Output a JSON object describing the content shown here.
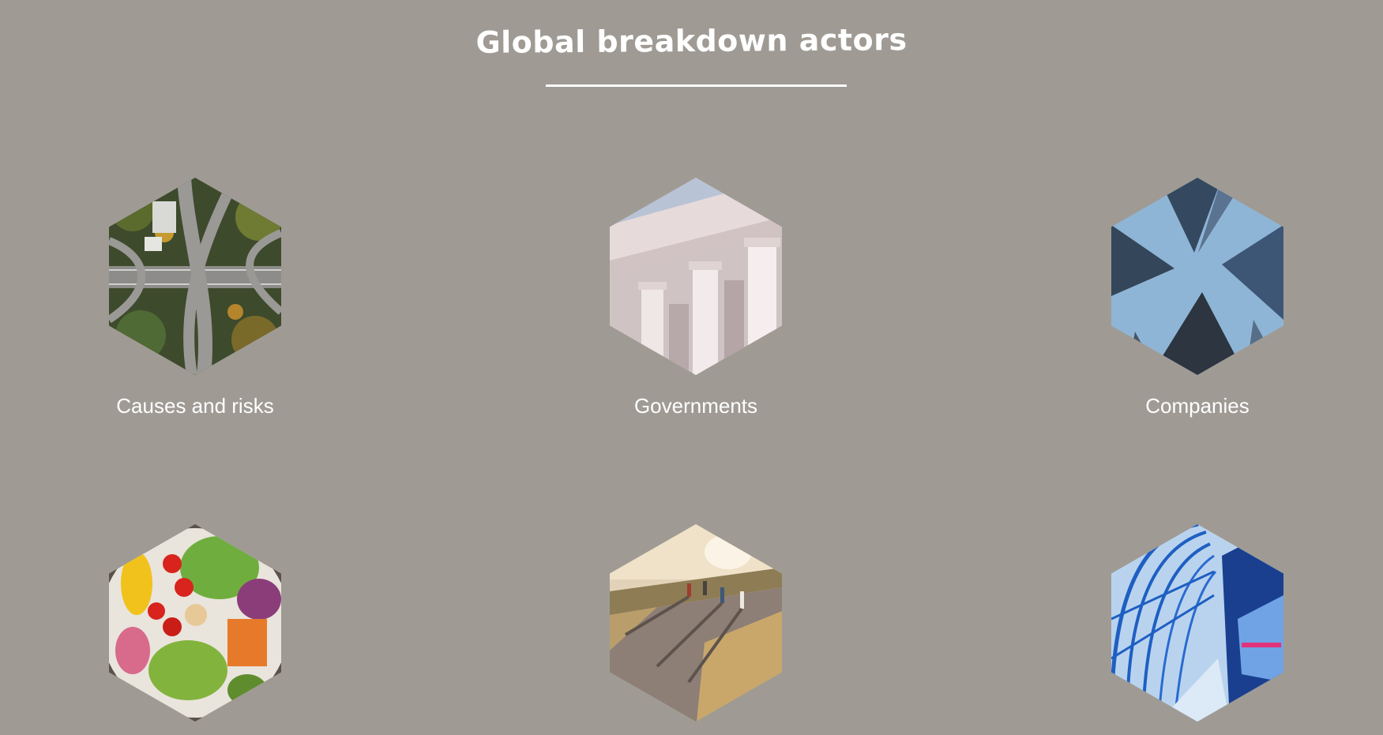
{
  "page": {
    "title": "Global breakdown actors"
  },
  "cards": [
    {
      "label": "Causes and risks",
      "image": "aerial-highway-interchange"
    },
    {
      "label": "Governments",
      "image": "classical-columns-building"
    },
    {
      "label": "Companies",
      "image": "skyscrapers-looking-up"
    },
    {
      "label": "",
      "image": "vegetable-salad-bowl"
    },
    {
      "label": "",
      "image": "people-walking-road-sunset"
    },
    {
      "label": "",
      "image": "blue-glass-tunnel-train"
    }
  ],
  "colors": {
    "background": "#9f9b94",
    "text": "#ffffff"
  }
}
